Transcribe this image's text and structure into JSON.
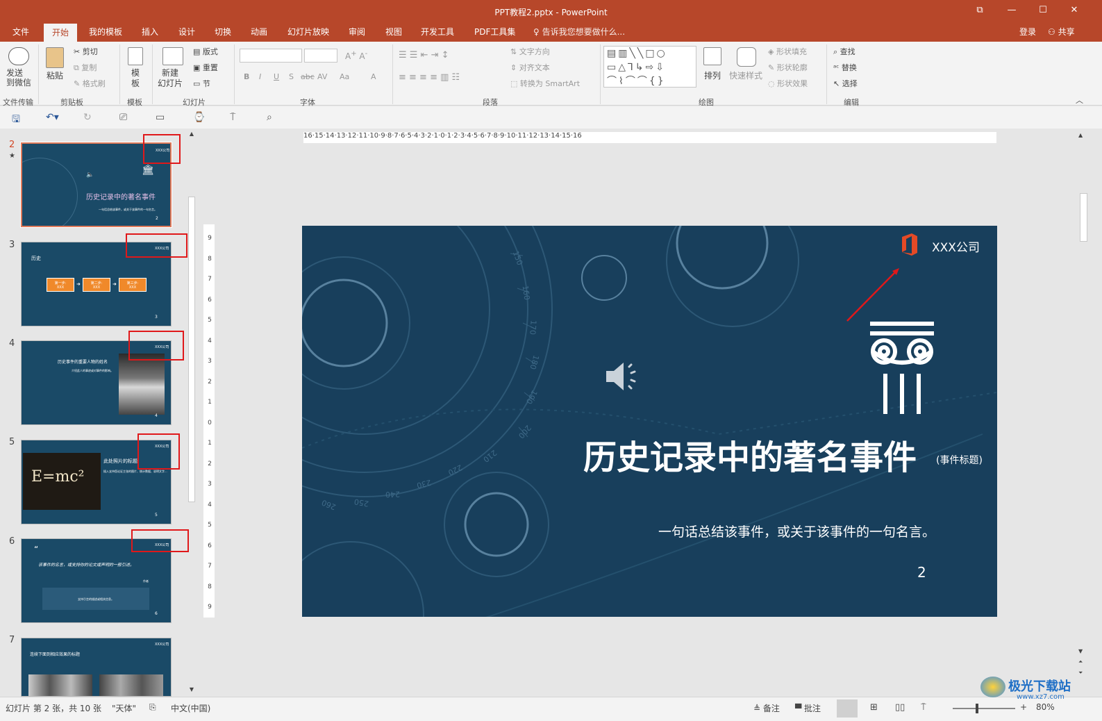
{
  "window": {
    "title": "PPT教程2.pptx - PowerPoint",
    "restore_icon": "⧉",
    "minimize": "—",
    "maximize": "☐",
    "close": "✕"
  },
  "tabs": [
    "文件",
    "开始",
    "我的模板",
    "插入",
    "设计",
    "切换",
    "动画",
    "幻灯片放映",
    "审阅",
    "视图",
    "开发工具",
    "PDF工具集"
  ],
  "tell_me": "告诉我您想要做什么...",
  "account": {
    "login": "登录",
    "share": "共享"
  },
  "ribbon": {
    "groups": {
      "transfer": "文件传输",
      "clipboard": "剪贴板",
      "template": "模板",
      "slides": "幻灯片",
      "font": "字体",
      "paragraph": "段落",
      "drawing": "绘图",
      "editing": "编辑"
    },
    "send_wechat": "发送\n到微信",
    "paste": "粘贴",
    "cut": "剪切",
    "copy": "复制",
    "format_painter": "格式刷",
    "template_btn": "模\n板",
    "new_slide": "新建\n幻灯片",
    "layout": "版式",
    "reset": "重置",
    "section": "节",
    "text_direction": "文字方向",
    "align_text": "对齐文本",
    "smartart": "转换为 SmartArt",
    "arrange": "排列",
    "quick_styles": "快速样式",
    "shape_fill": "形状填充",
    "shape_outline": "形状轮廓",
    "shape_effects": "形状效果",
    "find": "查找",
    "replace": "替换",
    "select": "选择",
    "font_buttons": [
      "B",
      "I",
      "U",
      "S",
      "abc",
      "AV",
      "Aa",
      "A"
    ]
  },
  "thumbnails": [
    {
      "num": "2",
      "star": "★",
      "title": "历史记录中的著名事件",
      "sub": "一句话总结该事件，或关于该事件的一句名言。",
      "page": "2",
      "company": "XXX公司"
    },
    {
      "num": "3",
      "title": "历史",
      "steps": [
        "第一步:",
        "第二步:",
        "第三步:"
      ],
      "step_sub": "XXX",
      "page": "3",
      "company": "XXX公司"
    },
    {
      "num": "4",
      "title": "历史事件的重要人物的姓名",
      "sub": "介绍此人的事迹或对事件的影响。",
      "page": "4",
      "company": "XXX公司"
    },
    {
      "num": "5",
      "title": "此处照片的标题",
      "formula": "E=mc²",
      "sub": "插入支持您论证主张的图片、统计数据、说明文字...",
      "page": "5",
      "company": "XXX公司"
    },
    {
      "num": "6",
      "quote_mark": "“",
      "title": "该事件的名言，或支持你的论文或声明的一般引述。",
      "author": "作者",
      "box": "支持引言的描述或相关信息。",
      "page": "6",
      "company": "XXX公司"
    },
    {
      "num": "7",
      "title": "连续下面到相应效果的标题",
      "company": "XXX公司"
    }
  ],
  "ruler_h": "16·15·14·13·12·11·10·9·8·7·6·5·4·3·2·1·0·1·2·3·4·5·6·7·8·9·10·11·12·13·14·15·16",
  "ruler_v": [
    "9",
    "8",
    "7",
    "6",
    "5",
    "4",
    "3",
    "2",
    "1",
    "0",
    "1",
    "2",
    "3",
    "4",
    "5",
    "6",
    "7",
    "8",
    "9"
  ],
  "slide": {
    "company": "XXX公司",
    "title": "历史记录中的著名事件",
    "title_note": "(事件标题)",
    "subtitle": "一句话总结该事件，或关于该事件的一句名言。",
    "page": "2",
    "dial_numbers": [
      "150",
      "160",
      "170",
      "180",
      "190",
      "200",
      "210",
      "220",
      "230",
      "240",
      "250",
      "260"
    ]
  },
  "status": {
    "slide_info": "幻灯片 第 2 张，共 10 张",
    "theme": "\"天体\"",
    "language": "中文(中国)",
    "notes": "备注",
    "comments": "批注",
    "zoom": "80%"
  },
  "watermark": {
    "site": "极光下载站",
    "url": "www.xz7.com"
  },
  "colors": {
    "accent": "#b7472a",
    "slide_bg": "#183f5c",
    "highlight_red": "#e0181a",
    "step_orange": "#f0892a"
  }
}
